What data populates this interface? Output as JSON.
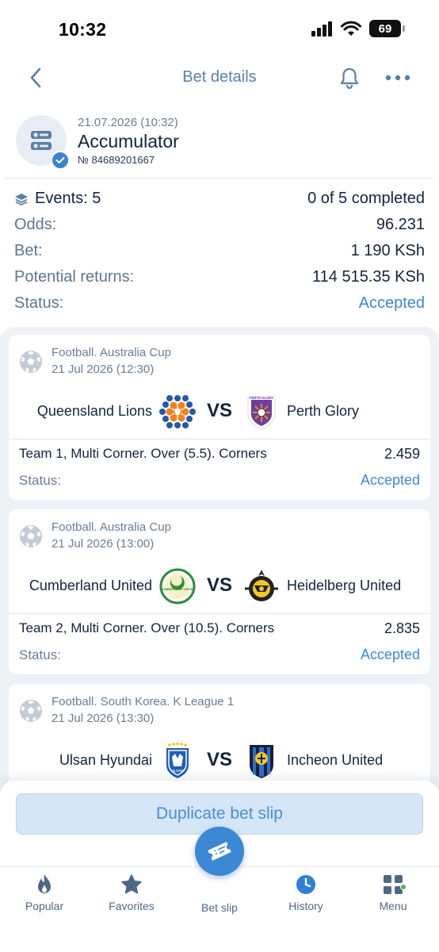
{
  "status_bar": {
    "time": "10:32",
    "battery": "69"
  },
  "header": {
    "title": "Bet details",
    "back_icon": "chevron-left-icon",
    "bell_icon": "bell-icon",
    "more_icon": "more-dots-icon"
  },
  "bet": {
    "date": "21.07.2026 (10:32)",
    "type": "Accumulator",
    "number": "№ 84689201667",
    "events_label": "Events: 5",
    "completed": "0 of 5 completed",
    "odds_label": "Odds:",
    "odds_value": "96.231",
    "bet_label": "Bet:",
    "bet_value": "1 190 KSh",
    "returns_label": "Potential returns:",
    "returns_value": "114 515.35 KSh",
    "status_label": "Status:",
    "status_value": "Accepted"
  },
  "events": [
    {
      "league": "Football. Australia Cup",
      "date": "21 Jul 2026 (12:30)",
      "team1": "Queensland Lions",
      "vs": "VS",
      "team2": "Perth Glory",
      "logo2_text": "PERTH GLORY",
      "bet": "Team 1, Multi Corner. Over (5.5). Corners",
      "odds": "2.459",
      "status_label": "Status:",
      "status": "Accepted"
    },
    {
      "league": "Football. Australia Cup",
      "date": "21 Jul 2026 (13:00)",
      "team1": "Cumberland United",
      "vs": "VS",
      "team2": "Heidelberg United",
      "logo1_text": "CUMBERLAND UNITED",
      "bet": "Team 2, Multi Corner. Over (10.5). Corners",
      "odds": "2.835",
      "status_label": "Status:",
      "status": "Accepted"
    },
    {
      "league": "Football. South Korea. K League 1",
      "date": "21 Jul 2026 (13:30)",
      "team1": "Ulsan Hyundai",
      "vs": "VS",
      "team2": "Incheon United",
      "logo1_text": "ULSAN"
    }
  ],
  "actions": {
    "duplicate": "Duplicate bet slip"
  },
  "tabs": [
    {
      "label": "Popular",
      "icon": "flame-icon"
    },
    {
      "label": "Favorites",
      "icon": "star-icon"
    },
    {
      "label": "Bet slip",
      "icon": "ticket-icon"
    },
    {
      "label": "History",
      "icon": "clock-icon"
    },
    {
      "label": "Menu",
      "icon": "grid-icon"
    }
  ],
  "colors": {
    "accent": "#3d88d4",
    "text_dark": "#13233f",
    "text_muted": "#6a7d95",
    "background_list": "#eef2f6"
  }
}
